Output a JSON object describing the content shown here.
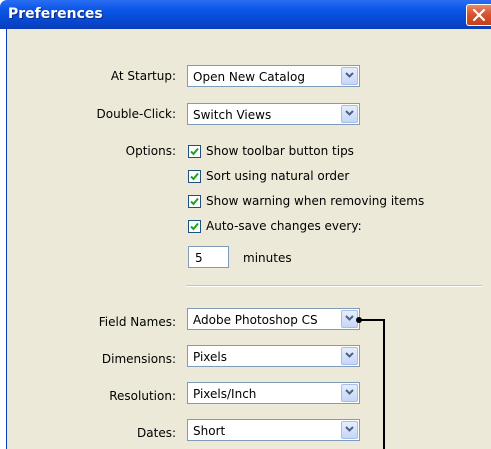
{
  "window": {
    "title": "Preferences"
  },
  "startup": {
    "label": "At Startup:",
    "value": "Open New Catalog"
  },
  "double_click": {
    "label": "Double-Click:",
    "value": "Switch Views"
  },
  "options": {
    "label": "Options:",
    "items": [
      {
        "label": "Show toolbar button tips",
        "checked": true
      },
      {
        "label": "Sort using natural order",
        "checked": true
      },
      {
        "label": "Show warning when removing items",
        "checked": true
      },
      {
        "label": "Auto-save changes every:",
        "checked": true
      }
    ],
    "autosave_minutes": "5",
    "minutes_label": "minutes"
  },
  "field_names": {
    "label": "Field Names:",
    "value": "Adobe Photoshop CS"
  },
  "dimensions": {
    "label": "Dimensions:",
    "value": "Pixels"
  },
  "resolution": {
    "label": "Resolution:",
    "value": "Pixels/Inch"
  },
  "dates": {
    "label": "Dates:",
    "value": "Short"
  },
  "colors": {
    "titlebar": "#0a55e6",
    "dialog_bg": "#ece9d8",
    "close": "#d8542e",
    "check": "#21a121"
  }
}
